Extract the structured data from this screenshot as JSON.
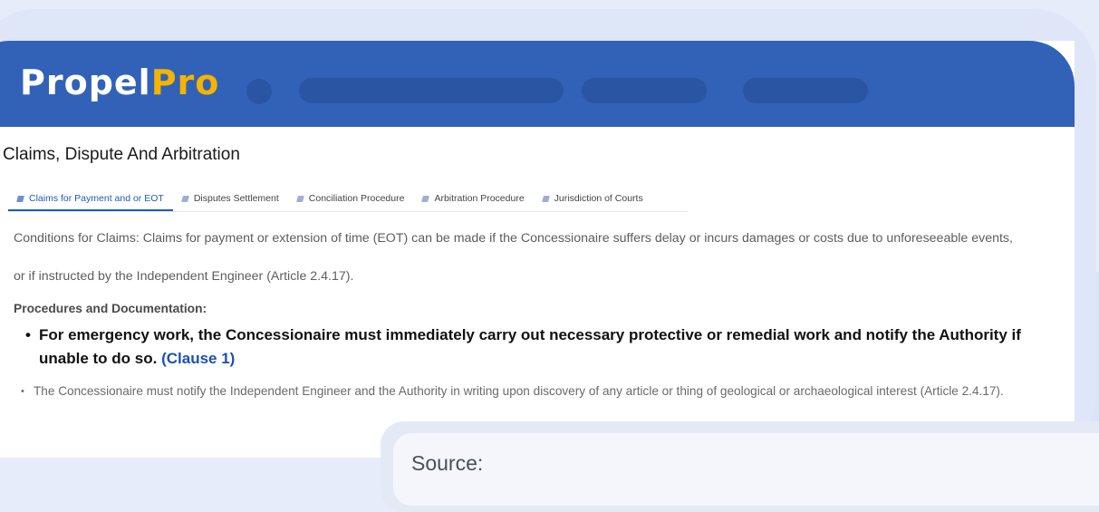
{
  "brand": {
    "part1": "Propel",
    "part2": "Pro"
  },
  "page_title": "Claims, Dispute And Arbitration",
  "tabs": [
    {
      "label": "Claims for Payment and or EOT",
      "active": true
    },
    {
      "label": "Disputes Settlement",
      "active": false
    },
    {
      "label": "Conciliation Procedure",
      "active": false
    },
    {
      "label": "Arbitration Procedure",
      "active": false
    },
    {
      "label": "Jurisdiction of Courts",
      "active": false
    }
  ],
  "content": {
    "intro": "Conditions for Claims: Claims for payment or extension of time (EOT) can be made if the Concessionaire suffers delay or incurs damages or costs due to unforeseeable events, or if instructed by the Independent Engineer (Article 2.4.17).",
    "subheading": "Procedures and Documentation:",
    "bullet_primary": {
      "text": "For emergency work, the Concessionaire must immediately carry out necessary protective or remedial work and notify the Authority if unable to do so.",
      "link": "(Clause 1)"
    },
    "bullet_secondary": "The Concessionaire must notify the Independent Engineer and the Authority in writing upon discovery of any article or thing of geological or archaeological interest (Article 2.4.17)."
  },
  "source": {
    "label": "Source:"
  },
  "colors": {
    "header": "#3162b8",
    "accent": "#f4b400",
    "link": "#1d4fb3"
  }
}
